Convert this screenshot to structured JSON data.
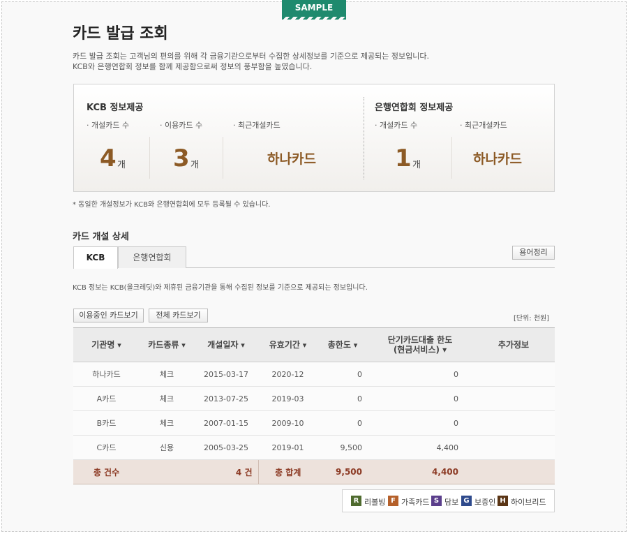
{
  "badge": "SAMPLE",
  "title": "카드 발급 조회",
  "desc": {
    "line1": "카드 발급 조회는 고객님의 편의를 위해 각 금융기관으로부터 수집한 상세정보를 기준으로 제공되는 정보입니다.",
    "line2": "KCB와 은행연합회 정보를 함께 제공함으로써 정보의 풍부함을 높였습니다."
  },
  "summary": {
    "kcb": {
      "title": "KCB 정보제공",
      "open_label": "· 개설카드 수",
      "open_count": "4",
      "use_label": "· 이용카드 수",
      "use_count": "3",
      "recent_label": "· 최근개설카드",
      "recent_card": "하나카드"
    },
    "bank": {
      "title": "은행연합회 정보제공",
      "open_label": "· 개설카드 수",
      "open_count": "1",
      "recent_label": "· 최근개설카드",
      "recent_card": "하나카드"
    },
    "unit": "개"
  },
  "note": "* 동일한 개설정보가 KCB와 은행연합회에 모두 등록될 수 있습니다.",
  "detail": {
    "heading": "카드 개설 상세",
    "tabs": [
      "KCB",
      "은행연합회"
    ],
    "glossary_button": "용어정리",
    "tab_desc": "KCB 정보는 KCB(올크레딧)와 제휴된 금융기관을 통해 수집된 정보를 기준으로 제공되는 정보입니다.",
    "view_active_button": "이용중인 카드보기",
    "view_all_button": "전체 카드보기",
    "unit_note": "[단위: 천원]"
  },
  "table": {
    "headers": {
      "company": "기관명",
      "type": "카드종류",
      "open_date": "개설일자",
      "expiry": "유효기간",
      "limit": "총한도",
      "cash_limit_1": "단기카드대출 한도",
      "cash_limit_2": "(현금서비스)",
      "extra": "추가정보"
    },
    "rows": [
      {
        "company": "하나카드",
        "type": "체크",
        "open_date": "2015-03-17",
        "expiry": "2020-12",
        "limit": "0",
        "cash_limit": "0"
      },
      {
        "company": "A카드",
        "type": "체크",
        "open_date": "2013-07-25",
        "expiry": "2019-03",
        "limit": "0",
        "cash_limit": "0"
      },
      {
        "company": "B카드",
        "type": "체크",
        "open_date": "2007-01-15",
        "expiry": "2009-10",
        "limit": "0",
        "cash_limit": "0"
      },
      {
        "company": "C카드",
        "type": "신용",
        "open_date": "2005-03-25",
        "expiry": "2019-01",
        "limit": "9,500",
        "cash_limit": "4,400"
      }
    ],
    "footer": {
      "count_label": "총 건수",
      "count_value": "4 건",
      "sum_label": "총 합계",
      "sum_limit": "9,500",
      "sum_cash_limit": "4,400"
    }
  },
  "legend": [
    {
      "code": "R",
      "label": "리볼빙",
      "color": "#4f6b2f"
    },
    {
      "code": "F",
      "label": "가족카드",
      "color": "#b5602a"
    },
    {
      "code": "S",
      "label": "담보",
      "color": "#5b3f8c"
    },
    {
      "code": "G",
      "label": "보증인",
      "color": "#2e4a8c"
    },
    {
      "code": "H",
      "label": "하이브리드",
      "color": "#5a3515"
    }
  ]
}
